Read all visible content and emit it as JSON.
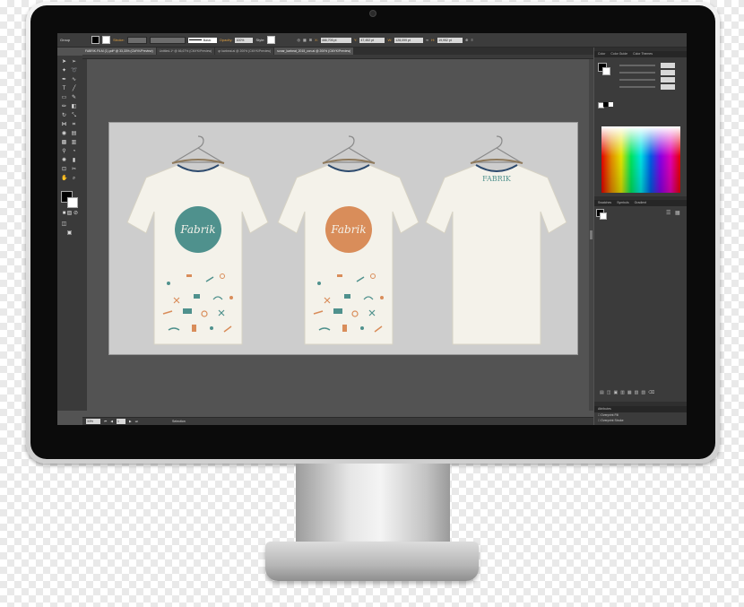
{
  "control_bar": {
    "selection_label": "Group",
    "stroke_label": "Stroke:",
    "profile_label": "Basic",
    "opacity_label": "Opacity:",
    "opacity_value": "100%",
    "style_label": "Style:",
    "x_value": "466,705 pt",
    "y_value": "47,452 pt",
    "w_value": "128,099 pt",
    "h_value": "19,952 pt"
  },
  "document_tabs": [
    {
      "label": "FABRIK.FILM (1).pdf* @ 33,33% (CMYK/Preview)"
    },
    {
      "label": "Untitled-1* @ 66,67% (CMYK/Preview)"
    },
    {
      "label": "qr karbeat.ai @ 200% (CMYK/Preview)"
    },
    {
      "label": "sonar_karbeat_2015_con.ai @ 200% (CMYK/Preview)"
    }
  ],
  "panels": {
    "color_tabs": [
      "Color",
      "Color Guide",
      "Color Themes"
    ],
    "swatches_tabs": [
      "Swatches",
      "Symbols",
      "Gradient"
    ],
    "attributes_tab": "Attributes",
    "overprint_fill": "Overprint Fill",
    "overprint_stroke": "Overprint Stroke"
  },
  "status_bar": {
    "zoom": "33%",
    "artboard": "1",
    "tool": "Selection"
  },
  "artwork": {
    "logo_text": "Fabrik",
    "back_logo_text": "FABRIK",
    "colors": {
      "teal": "#4f918d",
      "orange": "#d98d5a",
      "shirt": "#f4f2ea",
      "collar": "#2c4a6e"
    }
  }
}
